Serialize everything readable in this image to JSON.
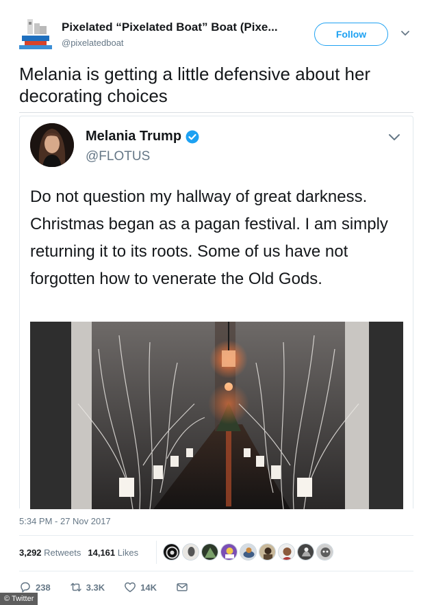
{
  "outer_tweet": {
    "display_name": "Pixelated “Pixelated Boat” Boat (Pixe...",
    "handle": "@pixelatedboat",
    "follow_label": "Follow",
    "text": "Melania is getting a little defensive about her decorating choices"
  },
  "quoted_tweet": {
    "display_name": "Melania Trump",
    "handle": "@FLOTUS",
    "verified": true,
    "text": "Do not question my hallway of great darkness. Christmas began as a pagan festival. I am simply returning it to its roots. Some of us have not forgotten how to venerate the Old Gods."
  },
  "meta": {
    "timestamp": "5:34 PM - 27 Nov 2017",
    "retweets_count": "3,292",
    "retweets_label": "Retweets",
    "likes_count": "14,161",
    "likes_label": "Likes",
    "liker_avatar_count": 9
  },
  "actions": {
    "replies": "238",
    "retweets": "3.3K",
    "likes": "14K"
  },
  "credit": "© Twitter",
  "colors": {
    "accent": "#1da1f2",
    "text_primary": "#14171a",
    "text_secondary": "#657786"
  },
  "icons": {
    "reply": "reply-icon",
    "retweet": "retweet-icon",
    "like": "heart-icon",
    "dm": "envelope-icon",
    "verified": "verified-badge-icon",
    "menu": "chevron-down-icon"
  }
}
